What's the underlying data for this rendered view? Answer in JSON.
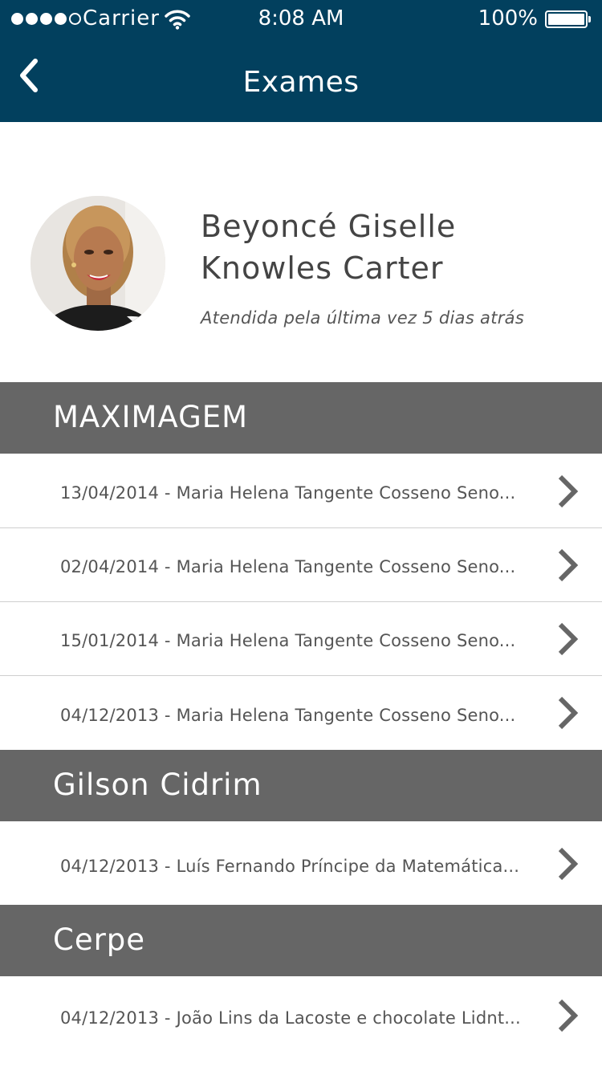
{
  "status_bar": {
    "carrier": "Carrier",
    "time": "8:08 AM",
    "battery": "100%"
  },
  "nav": {
    "title": "Exames",
    "back_icon": "chevron-left-icon"
  },
  "profile": {
    "name_line1": "Beyoncé Giselle",
    "name_line2": "Knowles Carter",
    "last_seen": "Atendida pela última vez 5 dias atrás"
  },
  "sections": [
    {
      "title": "MAXIMAGEM",
      "items": [
        "13/04/2014 - Maria Helena Tangente Cosseno Seno...",
        "02/04/2014 - Maria Helena Tangente Cosseno Seno...",
        "15/01/2014 - Maria Helena Tangente Cosseno Seno...",
        "04/12/2013 - Maria Helena Tangente Cosseno Seno..."
      ]
    },
    {
      "title": "Gilson Cidrim",
      "items": [
        "04/12/2013 - Luís Fernando Príncipe da Matemática..."
      ]
    },
    {
      "title": "Cerpe",
      "items": [
        "04/12/2013 - João Lins da Lacoste e chocolate Lidnt..."
      ]
    }
  ],
  "colors": {
    "nav_background": "#02405e",
    "section_background": "#666666"
  }
}
